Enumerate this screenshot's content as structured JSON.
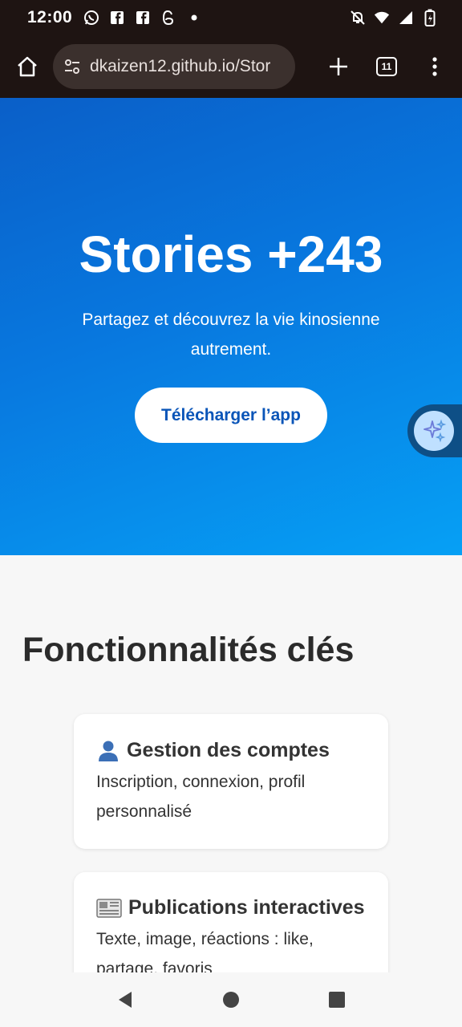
{
  "status": {
    "time": "12:00",
    "left_icons": [
      "whatsapp-icon",
      "facebook-icon",
      "facebook-icon",
      "threads-icon",
      "dot-icon"
    ],
    "right_icons": [
      "mute-icon",
      "wifi-icon",
      "signal-icon",
      "battery-icon"
    ]
  },
  "browser": {
    "url": "dkaizen12.github.io/Stor",
    "tab_count": "11"
  },
  "hero": {
    "title": "Stories +243",
    "subtitle": "Partagez et découvrez la vie kinosienne autrement.",
    "button_label": "Télécharger l’app",
    "colors": {
      "start": "#0a5fc8",
      "end": "#06a0f5",
      "button_text": "#0a55b8"
    }
  },
  "features": {
    "title": "Fonctionnalités clés",
    "cards": [
      {
        "icon": "person-icon",
        "title": "Gestion des comptes",
        "description": "Inscription, connexion, profil personnalisé"
      },
      {
        "icon": "newspaper-icon",
        "title": "Publications interactives",
        "description": "Texte, image, réactions : like, partage, favoris"
      }
    ]
  },
  "nav": {
    "icons": [
      "back-icon",
      "home-icon",
      "recents-icon"
    ]
  }
}
